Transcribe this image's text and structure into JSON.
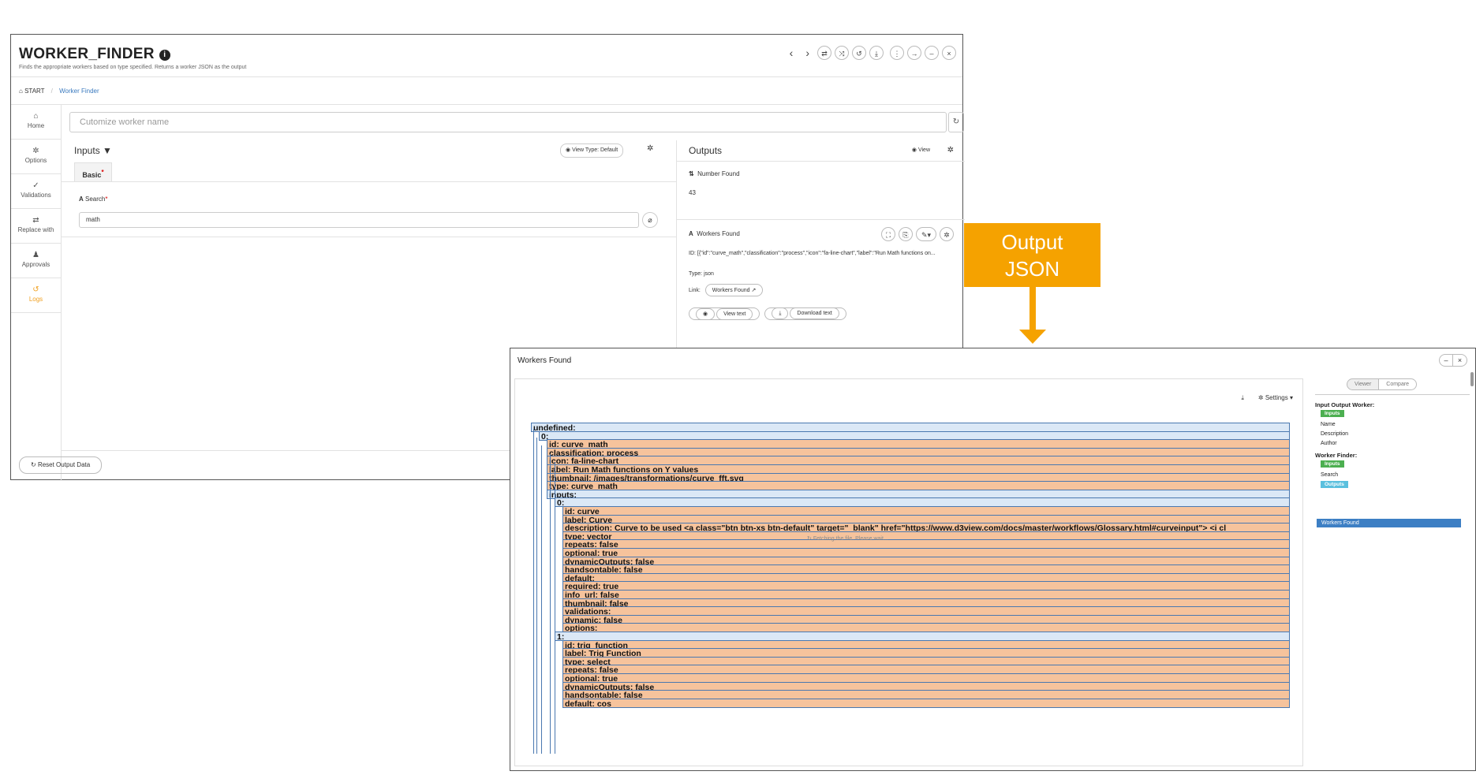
{
  "worker_window": {
    "title": "WORKER_FINDER",
    "subtitle": "Finds the appropriate workers based on type specified. Returns a worker JSON as the output",
    "breadcrumb": {
      "root": "START",
      "current": "Worker Finder"
    },
    "sidebar": [
      {
        "label": "Home",
        "icon": "⌂"
      },
      {
        "label": "Options",
        "icon": "✲"
      },
      {
        "label": "Validations",
        "icon": "✓"
      },
      {
        "label": "Replace with",
        "icon": "⇄"
      },
      {
        "label": "Approvals",
        "icon": "♟"
      },
      {
        "label": "Logs",
        "icon": "↺"
      }
    ],
    "name_placeholder": "Cutomize worker name",
    "inputs": {
      "heading": "Inputs",
      "view_type": "View Type: Default",
      "tab": "Basic",
      "search_label": "Search",
      "search_value": "math"
    },
    "outputs": {
      "heading": "Outputs",
      "view_label": "View",
      "number_found_label": "Number Found",
      "number_found_value": "43",
      "workers_found_label": "Workers Found",
      "id_label": "ID:",
      "id_value": "[{\"id\":\"curve_math\",\"classification\":\"process\",\"icon\":\"fa-line-chart\",\"label\":\"Run Math functions on...",
      "type_label": "Type:",
      "type_value": "json",
      "link_label": "Link:",
      "link_chip": "Workers Found",
      "view_text": "View text",
      "download_text": "Download text"
    },
    "reset_button": "Reset Output Data"
  },
  "callout": {
    "line1": "Output",
    "line2": "JSON",
    "color": "#f5a200"
  },
  "viewer": {
    "title": "Workers Found",
    "settings_label": "Settings",
    "fetching": "Fetching the file. Please wait...",
    "tabs": [
      "Viewer",
      "Compare"
    ],
    "sidebar": {
      "group1": "Input Output Worker:",
      "badge1": "Inputs",
      "items1": [
        "Name",
        "Description",
        "Author"
      ],
      "group2": "Worker Finder:",
      "badge2": "Inputs",
      "items2": [
        "Search"
      ],
      "badge3": "Outputs",
      "selected": "Workers Found"
    },
    "json_rows": [
      "undefined:",
      "0:",
      "id: curve_math",
      "classification: process",
      "icon: fa-line-chart",
      "label: Run Math functions on Y values",
      "thumbnail: /images/transformations/curve_fft.svg",
      "type: curve_math",
      "inputs:",
      "0:",
      "id: curve",
      "label: Curve",
      "description: Curve to be used <a class=\"btn btn-xs btn-default\" target=\"_blank\" href=\"https://www.d3view.com/docs/master/workflows/Glossary.html#curveinput\"> <i cl",
      "type: vector",
      "repeats: false",
      "optional: true",
      "dynamicOutputs: false",
      "handsontable: false",
      "default:",
      "required: true",
      "info_url: false",
      "thumbnail: false",
      "validations:",
      "dynamic: false",
      "options:",
      "1:",
      "id: trig_function",
      "label: Trig Function",
      "type: select",
      "repeats: false",
      "optional: true",
      "dynamicOutputs: false",
      "handsontable: false",
      "default: cos"
    ]
  }
}
